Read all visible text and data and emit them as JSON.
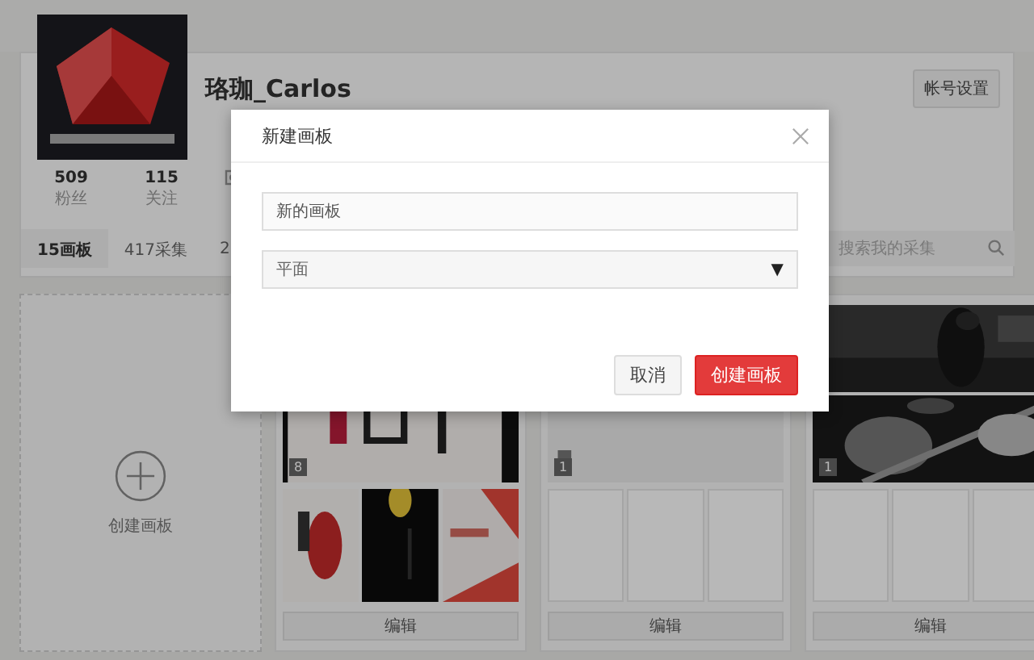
{
  "profile": {
    "name": "珞珈_Carlos",
    "settings_button": "帐号设置",
    "stats": [
      {
        "value": "509",
        "label": "粉丝"
      },
      {
        "value": "115",
        "label": "关注"
      }
    ]
  },
  "tabs": [
    {
      "label": "15画板",
      "selected": true
    },
    {
      "label": "417采集",
      "selected": false
    },
    {
      "label": "2",
      "selected": false
    }
  ],
  "search": {
    "placeholder": "搜索我的采集"
  },
  "boards": [
    {
      "kind": "create",
      "label": "创建画板"
    },
    {
      "kind": "board",
      "cover": [
        {
          "kind": "picture"
        }
      ],
      "count": "8",
      "thumbs": [
        {
          "kind": "picture"
        },
        {
          "kind": "picture"
        },
        {
          "kind": "picture"
        }
      ],
      "edit": "编辑"
    },
    {
      "kind": "board",
      "cover": [
        {
          "kind": "picture"
        }
      ],
      "count": "1",
      "thumbs": [
        {
          "kind": "empty"
        },
        {
          "kind": "empty"
        },
        {
          "kind": "empty"
        }
      ],
      "edit": "编辑"
    },
    {
      "kind": "board",
      "cover": [
        {
          "kind": "picture"
        },
        {
          "kind": "picture"
        }
      ],
      "count": "1",
      "thumbs": [
        {
          "kind": "empty"
        },
        {
          "kind": "empty"
        },
        {
          "kind": "empty"
        }
      ],
      "edit": "编辑"
    }
  ],
  "dialog": {
    "title": "新建画板",
    "name_value": "新的画板",
    "category": "平面",
    "arrow": "▼",
    "cancel": "取消",
    "confirm": "创建画板"
  }
}
